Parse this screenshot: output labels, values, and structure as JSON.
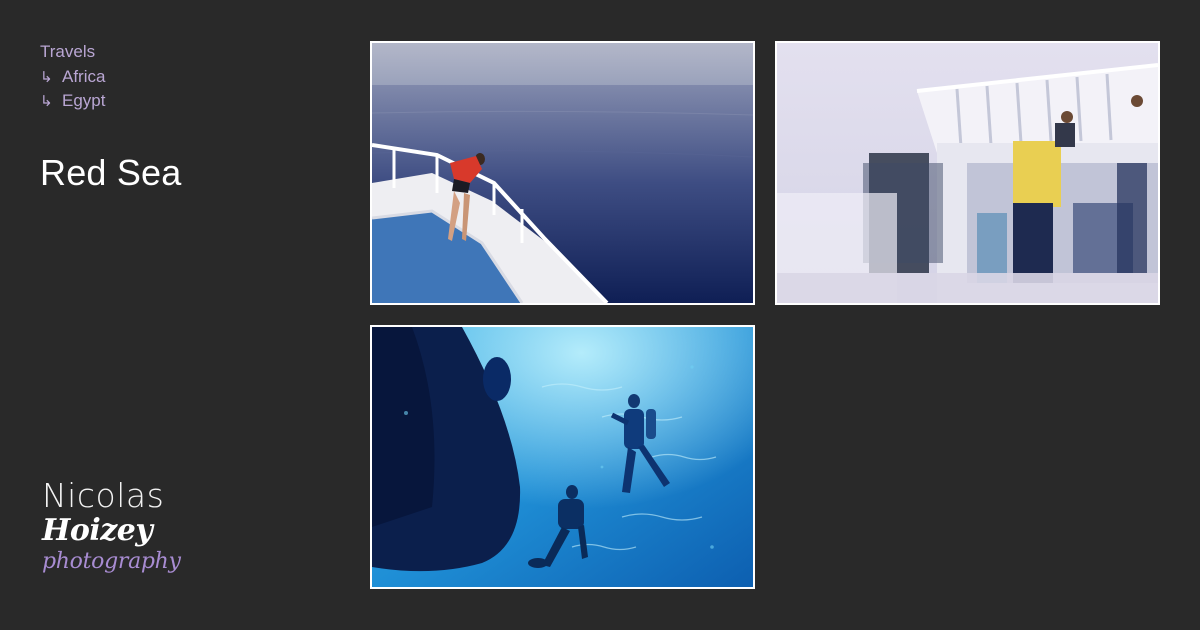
{
  "breadcrumb": [
    {
      "label": "Travels",
      "arrow": ""
    },
    {
      "label": "Africa",
      "arrow": "↳"
    },
    {
      "label": "Egypt",
      "arrow": "↳"
    }
  ],
  "page": {
    "title": "Red Sea"
  },
  "logo": {
    "line1": "Nicolas",
    "line2": "Hoizey",
    "line3": "photography"
  },
  "photos": [
    {
      "subject": "woman-on-boat-bow"
    },
    {
      "subject": "divers-on-boat-deck"
    },
    {
      "subject": "divers-underwater"
    }
  ],
  "colors": {
    "background": "#292929",
    "accent": "#b9a6d3",
    "frame": "#ffffff"
  }
}
